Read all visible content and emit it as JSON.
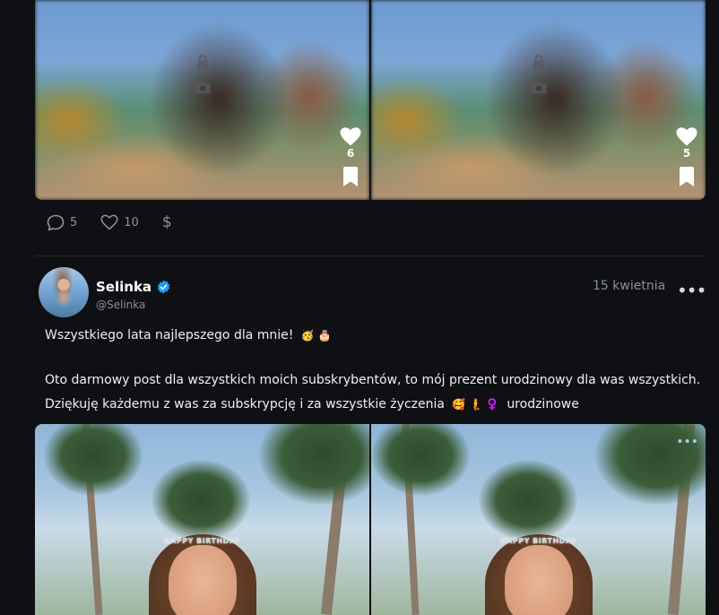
{
  "post1": {
    "media": [
      {
        "locked": true,
        "likes": "6"
      },
      {
        "locked": true,
        "likes": "5"
      }
    ],
    "actions": {
      "comments": "5",
      "likes": "10",
      "tip_symbol": "$"
    }
  },
  "post2": {
    "author": {
      "name": "Selinka",
      "handle": "@Selinka",
      "verified": true
    },
    "date": "15 kwietnia",
    "more": "•••",
    "text": {
      "line1": "Wszystkiego lata najlepszego dla mnie!",
      "line1_emojis": "🥳 🎂",
      "line2": "Oto darmowy post dla wszystkich moich subskrybentów, to mój prezent urodzinowy dla was wszystkich.",
      "line3_start": "Dziękuję każdemu z was za subskrypcję i za wszystkie życzenia",
      "line3_emojis": "🥰 🧜 ♀️",
      "line3_end": "urodzinowe"
    },
    "media": [
      {
        "tiara_text": "HAPPY BIRTHDAY"
      },
      {
        "tiara_text": "HAPPY BIRTHDAY",
        "corner_indicator": "•••"
      }
    ]
  },
  "colors": {
    "background": "#0f1013",
    "accent_verified": "#1d9bf0",
    "muted": "#8a8f9c"
  }
}
